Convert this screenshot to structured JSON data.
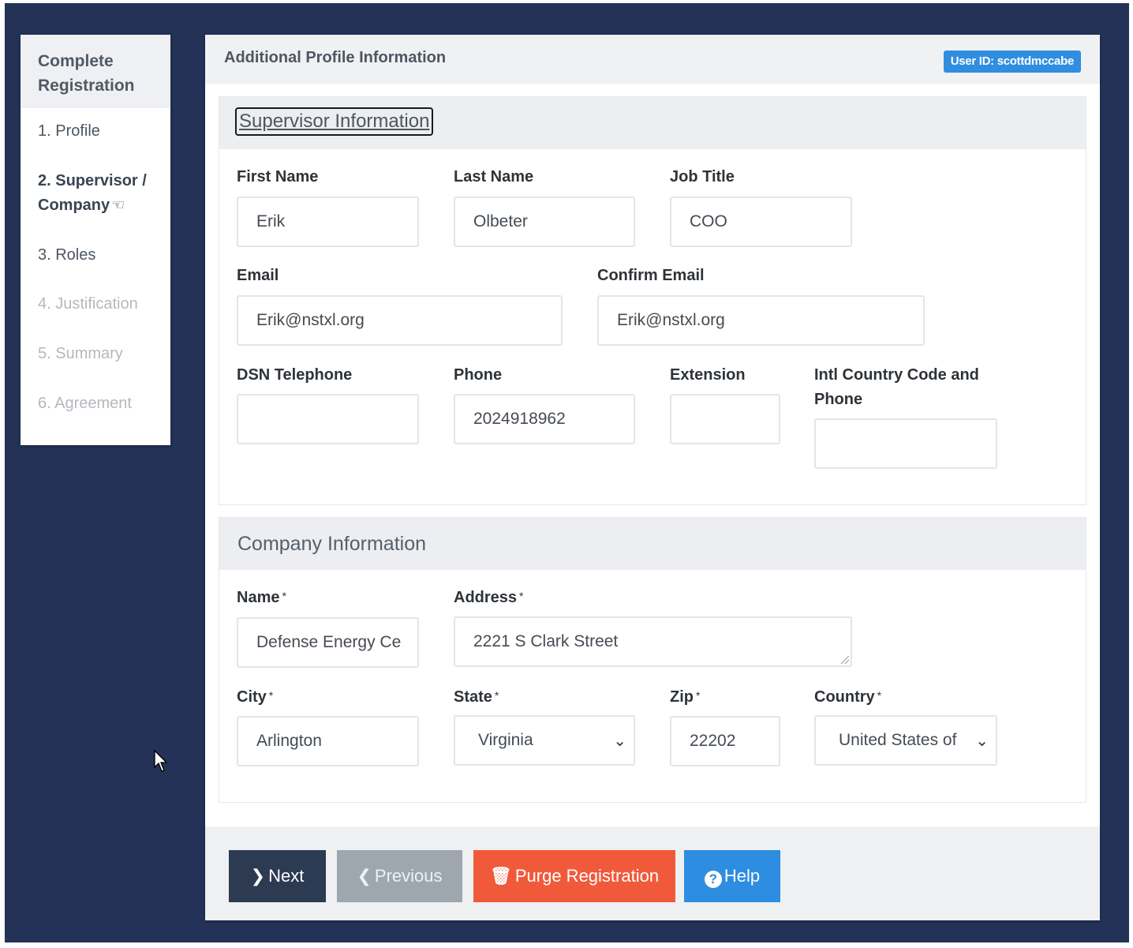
{
  "sidebar": {
    "title": "Complete Registration",
    "items": [
      {
        "label": "1. Profile",
        "state": "normal"
      },
      {
        "label": "2. Supervisor / Company",
        "state": "active"
      },
      {
        "label": "3. Roles",
        "state": "normal"
      },
      {
        "label": "4. Justification",
        "state": "disabled"
      },
      {
        "label": "5. Summary",
        "state": "disabled"
      },
      {
        "label": "6. Agreement",
        "state": "disabled"
      }
    ]
  },
  "header": {
    "title": "Additional Profile Information",
    "user_badge": "User ID: scottdmccabe"
  },
  "supervisor": {
    "section_title": "Supervisor Information",
    "first_name": {
      "label": "First Name",
      "value": "Erik"
    },
    "last_name": {
      "label": "Last Name",
      "value": "Olbeter"
    },
    "job_title": {
      "label": "Job Title",
      "value": "COO"
    },
    "email": {
      "label": "Email",
      "value": "Erik@nstxl.org"
    },
    "confirm_email": {
      "label": "Confirm Email",
      "value": "Erik@nstxl.org"
    },
    "dsn_telephone": {
      "label": "DSN Telephone",
      "value": ""
    },
    "phone": {
      "label": "Phone",
      "value": "2024918962"
    },
    "extension": {
      "label": "Extension",
      "value": ""
    },
    "intl_phone": {
      "label_line1": "Intl Country Code and",
      "label_line2": "Phone",
      "value": ""
    }
  },
  "company": {
    "section_title": "Company Information",
    "required_mark": "*",
    "name": {
      "label": "Name",
      "value": "Defense Energy Ce"
    },
    "address": {
      "label": "Address",
      "value": "2221 S Clark Street"
    },
    "city": {
      "label": "City",
      "value": "Arlington"
    },
    "state": {
      "label": "State",
      "value": "Virginia"
    },
    "zip": {
      "label": "Zip",
      "value": "22202"
    },
    "country": {
      "label": "Country",
      "value": "United States of"
    }
  },
  "buttons": {
    "next": "Next",
    "previous": "Previous",
    "purge": "Purge Registration",
    "help": "Help"
  },
  "colors": {
    "background": "#233256",
    "next": "#2c3a52",
    "previous": "#9ea7ad",
    "purge": "#f05a3b",
    "help": "#2d8de0",
    "badge": "#2f8ee0"
  }
}
